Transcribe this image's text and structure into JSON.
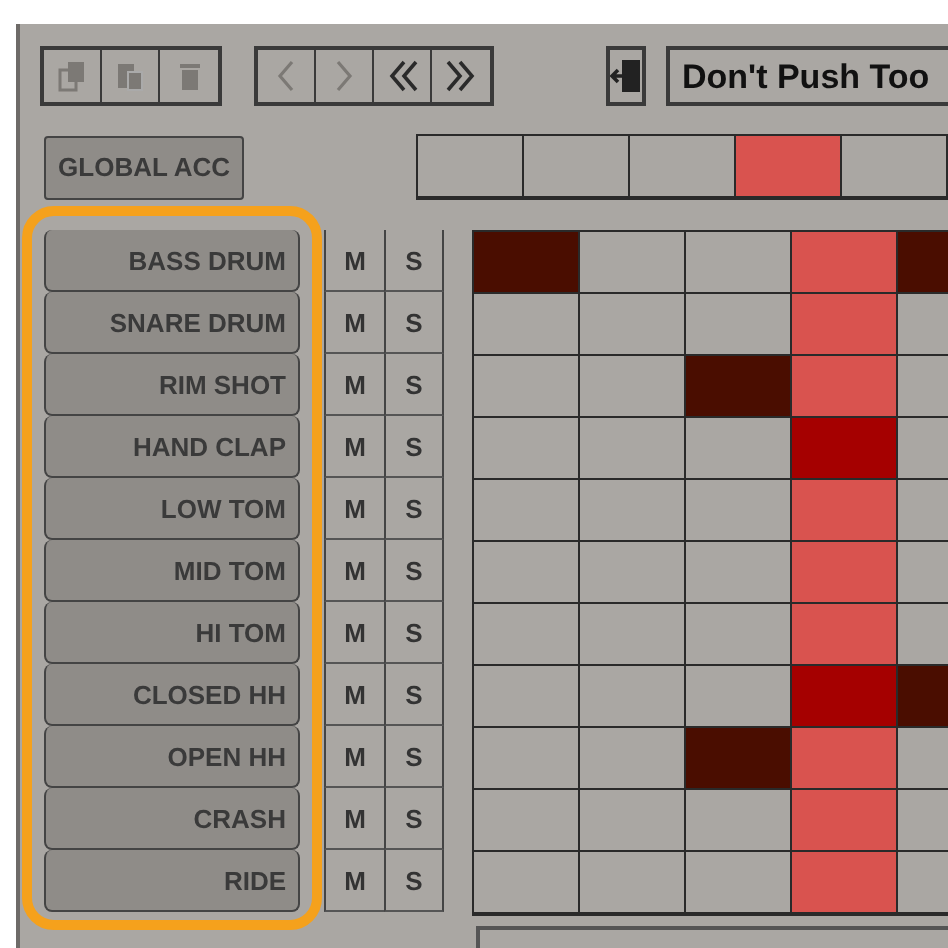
{
  "toolbar": {
    "edit_buttons": [
      {
        "kind": "copy",
        "disabled": true
      },
      {
        "kind": "paste",
        "disabled": true
      },
      {
        "kind": "delete",
        "disabled": true
      }
    ],
    "nav_buttons": [
      {
        "kind": "prev",
        "disabled": true
      },
      {
        "kind": "next",
        "disabled": true
      },
      {
        "kind": "first",
        "disabled": false
      },
      {
        "kind": "last",
        "disabled": false
      }
    ],
    "pattern_name": "Don't Push Too"
  },
  "global_accent": {
    "label": "GLOBAL ACC"
  },
  "step_columns": [
    {
      "current": false
    },
    {
      "current": false
    },
    {
      "current": false
    },
    {
      "current": true
    },
    {
      "current": false
    }
  ],
  "tracks_highlighted": true,
  "tracks": [
    {
      "name": "BASS DRUM",
      "mute": "M",
      "solo": "S",
      "steps": [
        true,
        false,
        false,
        false,
        true
      ]
    },
    {
      "name": "SNARE DRUM",
      "mute": "M",
      "solo": "S",
      "steps": [
        false,
        false,
        false,
        false,
        false
      ]
    },
    {
      "name": "RIM SHOT",
      "mute": "M",
      "solo": "S",
      "steps": [
        false,
        false,
        true,
        false,
        false
      ]
    },
    {
      "name": "HAND CLAP",
      "mute": "M",
      "solo": "S",
      "steps": [
        false,
        false,
        false,
        true,
        false
      ]
    },
    {
      "name": "LOW TOM",
      "mute": "M",
      "solo": "S",
      "steps": [
        false,
        false,
        false,
        false,
        false
      ]
    },
    {
      "name": "MID TOM",
      "mute": "M",
      "solo": "S",
      "steps": [
        false,
        false,
        false,
        false,
        false
      ]
    },
    {
      "name": "HI TOM",
      "mute": "M",
      "solo": "S",
      "steps": [
        false,
        false,
        false,
        false,
        false
      ]
    },
    {
      "name": "CLOSED HH",
      "mute": "M",
      "solo": "S",
      "steps": [
        false,
        false,
        false,
        true,
        true
      ]
    },
    {
      "name": "OPEN HH",
      "mute": "M",
      "solo": "S",
      "steps": [
        false,
        false,
        true,
        false,
        false
      ]
    },
    {
      "name": "CRASH",
      "mute": "M",
      "solo": "S",
      "steps": [
        false,
        false,
        false,
        false,
        false
      ]
    },
    {
      "name": "RIDE",
      "mute": "M",
      "solo": "S",
      "steps": [
        false,
        false,
        false,
        false,
        false
      ]
    }
  ]
}
